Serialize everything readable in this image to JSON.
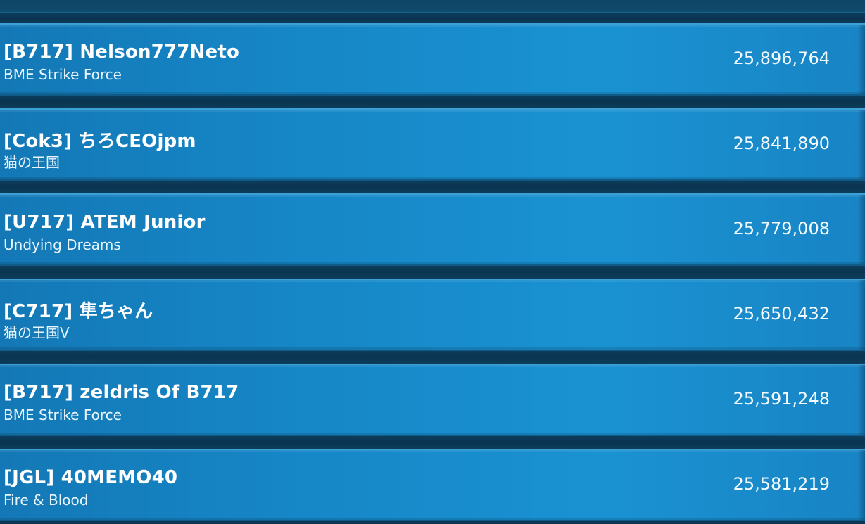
{
  "leaderboard": {
    "rows": [
      {
        "name": "[B717] Nelson777Neto",
        "alliance": "BME Strike Force",
        "score": "25,896,764"
      },
      {
        "name": "[Cok3] ちろCEOjpm",
        "alliance": "猫の王国",
        "score": "25,841,890"
      },
      {
        "name": "[U717] ATEM Junior",
        "alliance": "Undying Dreams",
        "score": "25,779,008"
      },
      {
        "name": "[C717] 隼ちゃん",
        "alliance": "猫の王国V",
        "score": "25,650,432"
      },
      {
        "name": "[B717] zeldris Of B717",
        "alliance": "BME Strike Force",
        "score": "25,591,248"
      },
      {
        "name": "[JGL] 40MEMO40",
        "alliance": "Fire & Blood",
        "score": "25,581,219"
      }
    ]
  }
}
